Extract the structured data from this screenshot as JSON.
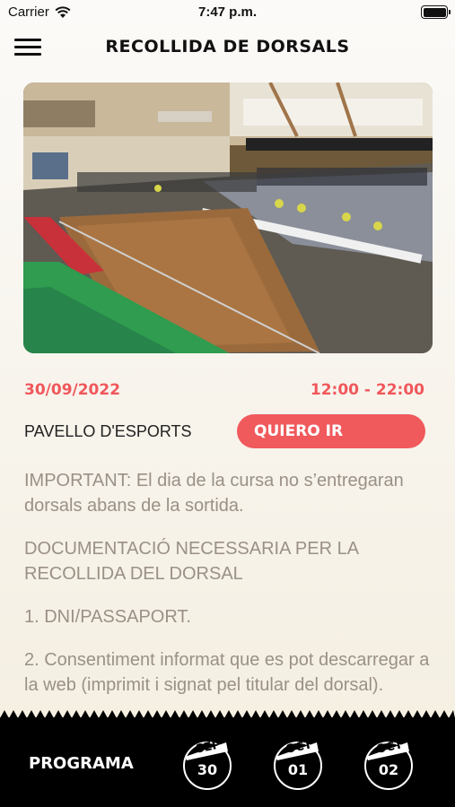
{
  "status_bar": {
    "carrier": "Carrier",
    "time": "7:47 p.m."
  },
  "header": {
    "title": "RECOLLIDA DE DORSALS"
  },
  "event": {
    "date": "30/09/2022",
    "time_range": "12:00 - 22:00",
    "venue": "PAVELLO D'ESPORTS",
    "go_button": "QUIERO IR"
  },
  "content": {
    "paragraphs": [
      "IMPORTANT: El dia de la cursa no s’entregaran dorsals abans de la sortida.",
      "DOCUMENTACIÓ NECESSARIA PER LA RECOLLIDA DEL DORSAL",
      "1. DNI/PASSAPORT.",
      "2. Consentiment informat que es pot descarregar a la web (imprimit i signat pel titular del dorsal)."
    ]
  },
  "bottom_nav": {
    "programa": "PROGRAMA",
    "days": [
      {
        "month": "SEP",
        "day": "30"
      },
      {
        "month": "OCT",
        "day": "01"
      },
      {
        "month": "OCT",
        "day": "02"
      }
    ]
  },
  "colors": {
    "accent": "#f05a5d",
    "text_muted": "#9a9086",
    "bar": "#000000"
  },
  "icons": {
    "menu": "hamburger-icon",
    "wifi": "wifi-icon",
    "battery": "battery-icon"
  }
}
